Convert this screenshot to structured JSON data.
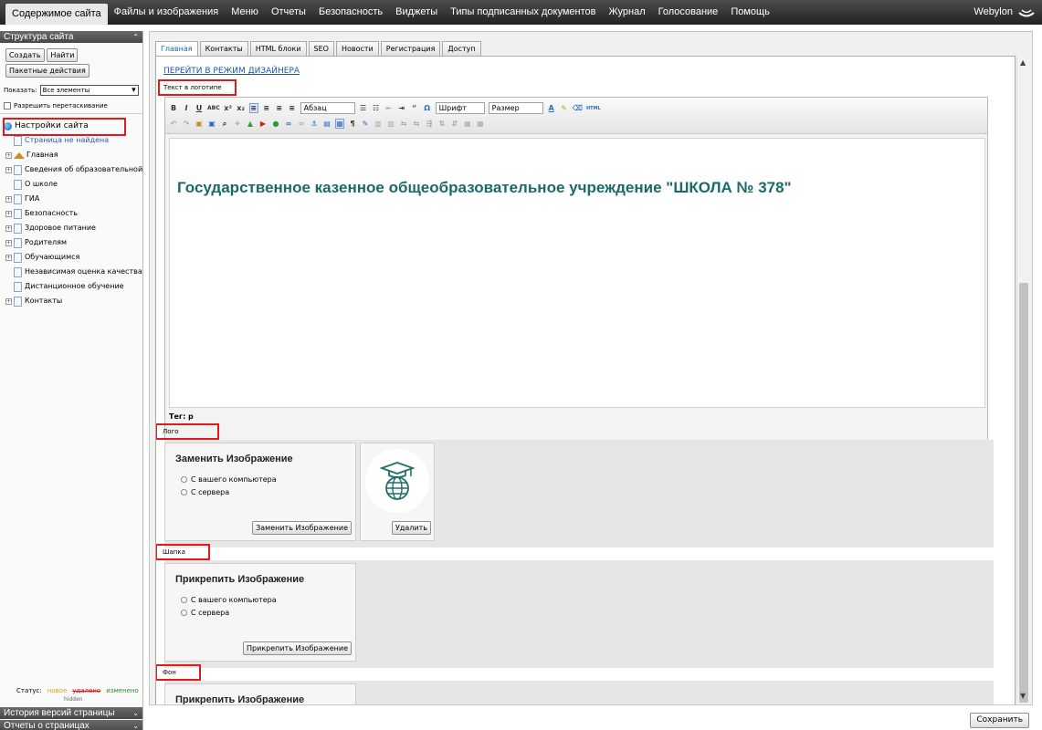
{
  "topbar": {
    "items": [
      "Содержимое сайта",
      "Файлы и изображения",
      "Меню",
      "Отчеты",
      "Безопасность",
      "Виджеты",
      "Типы подписанных документов",
      "Журнал",
      "Голосование",
      "Помощь"
    ],
    "brand": "Webylon"
  },
  "sidebar": {
    "title": "Структура сайта",
    "create": "Создать",
    "find": "Найти",
    "batch": "Пакетные действия",
    "show_label": "Показать:",
    "show_value": "Все элементы",
    "drag_label": "Разрешить перетаскивание",
    "tree": [
      {
        "label": "Настройки сайта",
        "kind": "globe"
      },
      {
        "label": "Страница не найдена",
        "kind": "doc-link"
      },
      {
        "label": "Главная",
        "kind": "home"
      },
      {
        "label": "Сведения об образовательной",
        "kind": "doc"
      },
      {
        "label": "О школе",
        "kind": "doc"
      },
      {
        "label": "ГИА",
        "kind": "doc"
      },
      {
        "label": "Безопасность",
        "kind": "doc"
      },
      {
        "label": "Здоровое питание",
        "kind": "doc"
      },
      {
        "label": "Родителям",
        "kind": "doc"
      },
      {
        "label": "Обучающимся",
        "kind": "doc"
      },
      {
        "label": "Независимая оценка качества",
        "kind": "doc"
      },
      {
        "label": "Дистанционное обучение",
        "kind": "doc"
      },
      {
        "label": "Контакты",
        "kind": "doc"
      }
    ],
    "status_label": "Статус:",
    "status_new": "новое",
    "status_deleted": "удалено",
    "status_changed": "изменено",
    "status_hidden": "hidden",
    "history": "История версий страницы",
    "reports": "Отчеты о страницах"
  },
  "tabs": [
    "Главная",
    "Контакты",
    "HTML блоки",
    "SEO",
    "Новости",
    "Регистрация",
    "Доступ"
  ],
  "designer_link": "ПЕРЕЙТИ В РЕЖИМ ДИЗАЙНЕРА",
  "logo_text_label": "Текст в логотипе",
  "editor": {
    "format_select": "Абзац",
    "font_select": "Шрифт",
    "size_select": "Размер",
    "heading": "Государственное казенное общеобразовательное учреждение \"ШКОЛА № 378\"",
    "path": "Тег: p"
  },
  "logo_section": {
    "label": "Лого",
    "title": "Заменить Изображение",
    "opt_computer": "С вашего компьютера",
    "opt_server": "С сервера",
    "button": "Заменить Изображение",
    "delete": "Удалить"
  },
  "header_section": {
    "label": "Шапка",
    "title": "Прикрепить Изображение",
    "opt_computer": "С вашего компьютера",
    "opt_server": "С сервера",
    "button": "Прикрепить Изображение"
  },
  "bg_section": {
    "label": "Фон",
    "title": "Прикрепить Изображение"
  },
  "save_button": "Сохранить"
}
